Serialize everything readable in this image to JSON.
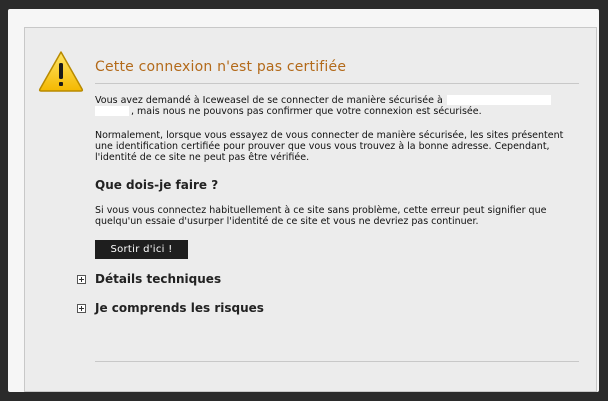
{
  "error_page": {
    "title": "Cette connexion n'est pas certifiée",
    "intro_before": "Vous avez demandé à Iceweasel de se connecter de manière sécurisée à",
    "intro_after": ", mais nous ne pouvons pas confirmer que votre connexion est sécurisée.",
    "explanation": "Normalement, lorsque vous essayez de vous connecter de manière sécurisée, les sites présentent une identification certifiée pour prouver que vous vous trouvez à la bonne adresse. Cependant, l'identité de ce site ne peut pas être vérifiée.",
    "what_to_do_heading": "Que dois-je faire ?",
    "what_to_do_text": "Si vous vous connectez habituellement à ce site sans problème, cette erreur peut signifier que quelqu'un essaie d'usurper l'identité de ce site et vous ne devriez pas continuer.",
    "exit_button": "Sortir d'ici !",
    "technical_details": "Détails techniques",
    "understand_risks": "Je comprends les risques"
  },
  "colors": {
    "title": "#b36a1a",
    "panel_bg": "#ececec",
    "page_bg": "#2b2b2b",
    "button_bg": "#1e1e1e"
  },
  "icons": {
    "warning": "warning-triangle-icon",
    "expand": "plus-box-icon"
  }
}
